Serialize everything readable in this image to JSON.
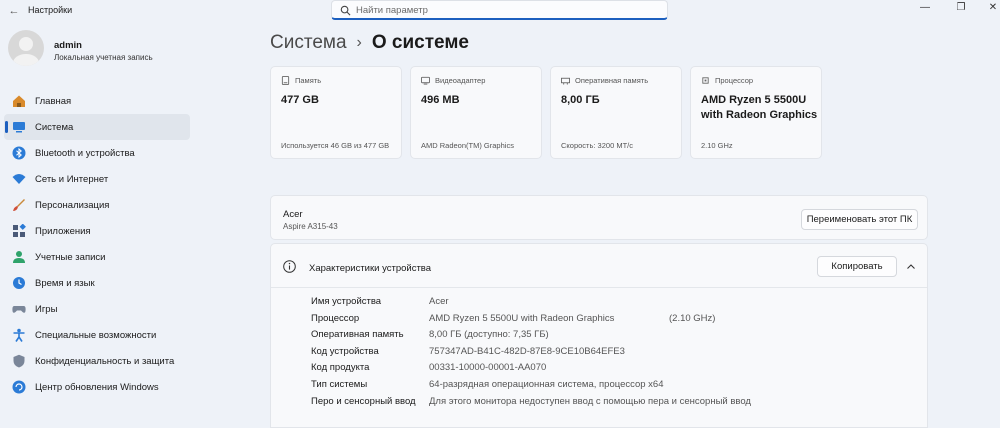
{
  "app": {
    "title": "Настройки"
  },
  "search": {
    "placeholder": "Найти параметр"
  },
  "user": {
    "name": "admin",
    "account_type": "Локальная учетная запись"
  },
  "nav": [
    {
      "label": "Главная",
      "icon": "home-icon"
    },
    {
      "label": "Система",
      "icon": "system-icon",
      "active": true
    },
    {
      "label": "Bluetooth и устройства",
      "icon": "bluetooth-icon"
    },
    {
      "label": "Сеть и Интернет",
      "icon": "network-icon"
    },
    {
      "label": "Персонализация",
      "icon": "brush-icon"
    },
    {
      "label": "Приложения",
      "icon": "apps-icon"
    },
    {
      "label": "Учетные записи",
      "icon": "accounts-icon"
    },
    {
      "label": "Время и язык",
      "icon": "globe-clock-icon"
    },
    {
      "label": "Игры",
      "icon": "gamepad-icon"
    },
    {
      "label": "Специальные возможности",
      "icon": "accessibility-icon"
    },
    {
      "label": "Конфиденциальность и защита",
      "icon": "shield-icon"
    },
    {
      "label": "Центр обновления Windows",
      "icon": "update-icon"
    }
  ],
  "breadcrumb": {
    "parent": "Система",
    "current": "О системе"
  },
  "cards": [
    {
      "label": "Память",
      "value": "477 GB",
      "sub": "Используется 46 GB из 477 GB",
      "icon": "storage-icon"
    },
    {
      "label": "Видеоадаптер",
      "value": "496 MB",
      "sub": "AMD Radeon(TM) Graphics",
      "icon": "gpu-icon"
    },
    {
      "label": "Оперативная память",
      "value": "8,00 ГБ",
      "sub": "Скорость: 3200 MT/c",
      "icon": "ram-icon"
    },
    {
      "label": "Процессор",
      "value": "AMD Ryzen 5 5500U with Radeon Graphics",
      "sub": "2.10 GHz",
      "icon": "cpu-icon"
    }
  ],
  "pc": {
    "vendor": "Acer",
    "model": "Aspire A315-43",
    "rename_label": "Переименовать этот ПК"
  },
  "specs": {
    "title": "Характеристики устройства",
    "copy_label": "Копировать",
    "rows": [
      {
        "key": "Имя устройства",
        "value": "Acer",
        "extra": ""
      },
      {
        "key": "Процессор",
        "value": "AMD Ryzen 5 5500U with Radeon Graphics",
        "extra": "(2.10 GHz)"
      },
      {
        "key": "Оперативная память",
        "value": "8,00 ГБ (доступно: 7,35 ГБ)",
        "extra": ""
      },
      {
        "key": "Код устройства",
        "value": "757347AD-B41C-482D-87E8-9CE10B64EFE3",
        "extra": ""
      },
      {
        "key": "Код продукта",
        "value": "00331-10000-00001-AA070",
        "extra": ""
      },
      {
        "key": "Тип системы",
        "value": "64-разрядная операционная система, процессор x64",
        "extra": ""
      },
      {
        "key": "Перо и сенсорный ввод",
        "value": "Для этого монитора недоступен ввод с помощью пера и сенсорный ввод",
        "extra": ""
      }
    ]
  },
  "colors": {
    "accent": "#1c5fbf",
    "background": "#eef2f8",
    "card": "#f8f9fb"
  }
}
